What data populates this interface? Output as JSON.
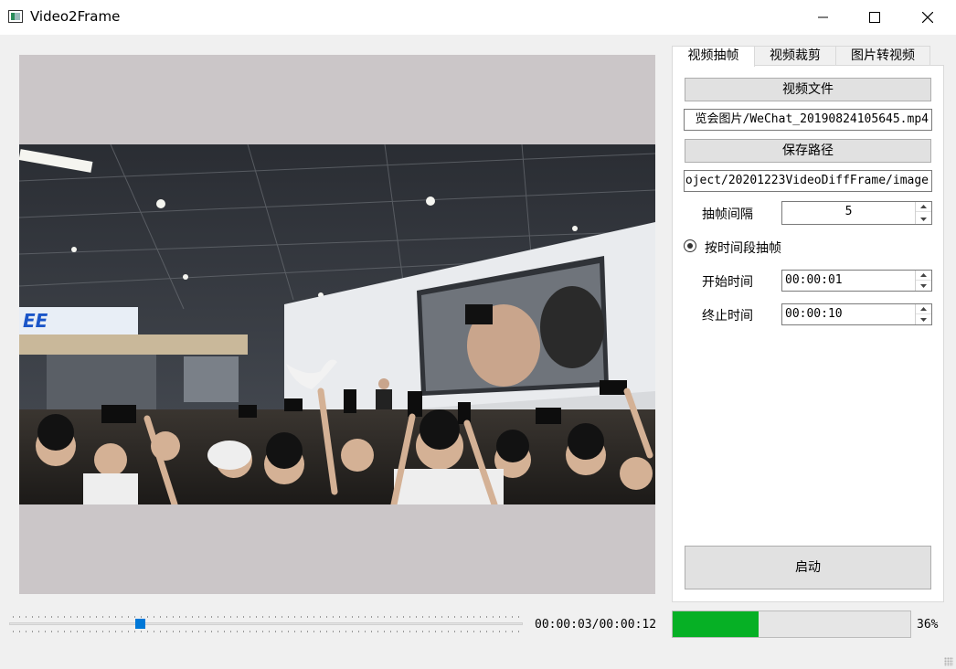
{
  "window": {
    "title": "Video2Frame"
  },
  "tabs": [
    {
      "label": "视频抽帧",
      "active": true
    },
    {
      "label": "视频裁剪",
      "active": false
    },
    {
      "label": "图片转视频",
      "active": false
    }
  ],
  "panel": {
    "video_file_button": "视频文件",
    "video_file_path": "览会图片/WeChat_20190824105645.mp4",
    "save_path_button": "保存路径",
    "save_path_value": "oject/20201223VideoDiffFrame/image",
    "interval_label": "抽帧间隔",
    "interval_value": "5",
    "by_time_label": "按时间段抽帧",
    "start_label": "开始时间",
    "start_value": "00:00:01",
    "end_label": "终止时间",
    "end_value": "00:00:10",
    "start_button": "启动"
  },
  "player": {
    "time_readout": "00:00:03/00:00:12",
    "slider_position": 0.25
  },
  "progress": {
    "value": 0.36,
    "text": "36%",
    "color": "#06b025"
  },
  "colors": {
    "accent": "#0078d7",
    "video_background": "#cbc6c8"
  }
}
